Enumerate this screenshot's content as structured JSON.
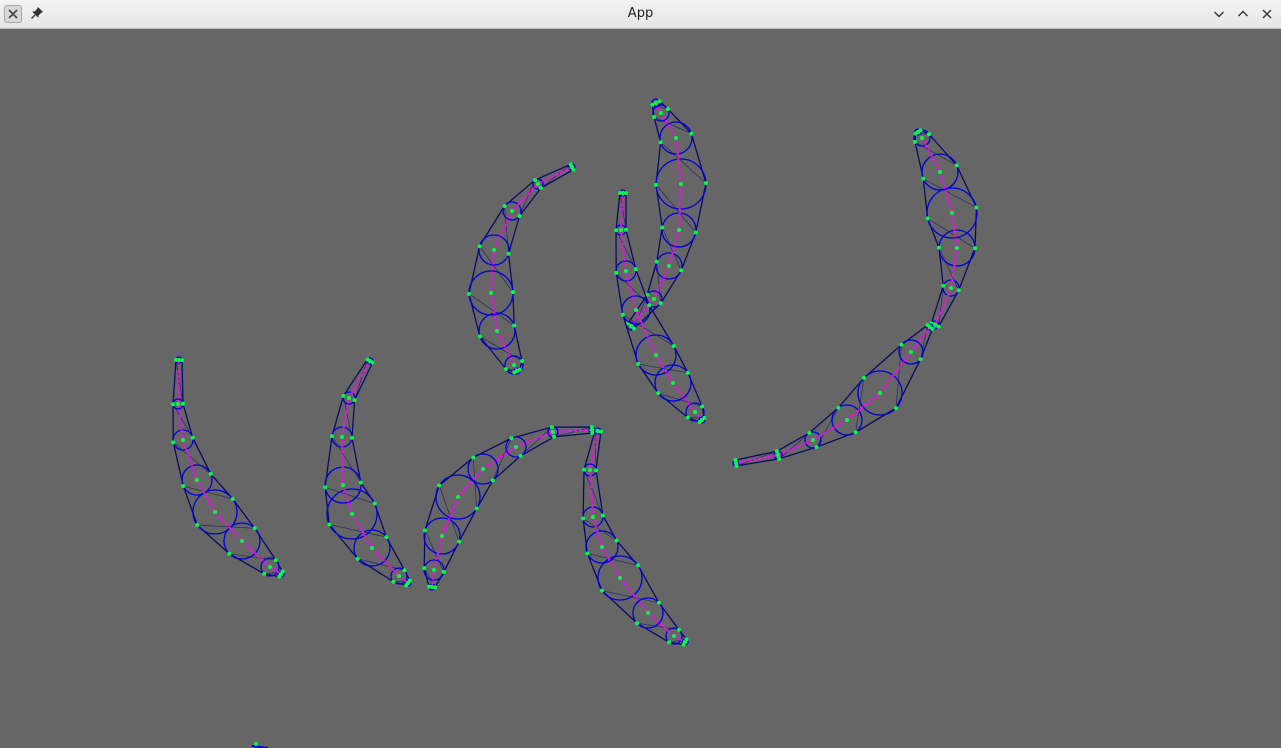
{
  "window": {
    "title": "App"
  },
  "titlebar": {
    "app_icon": "x-app-icon",
    "pin_icon": "pin-icon",
    "minimize_icon": "chevron-down-icon",
    "maximize_icon": "chevron-up-icon",
    "close_icon": "close-icon"
  },
  "colors": {
    "background": "#666666",
    "outline": "#0000dd",
    "outline_dark": "#0b0b66",
    "spine": "#ff00ff",
    "joint": "#00ff44"
  }
}
